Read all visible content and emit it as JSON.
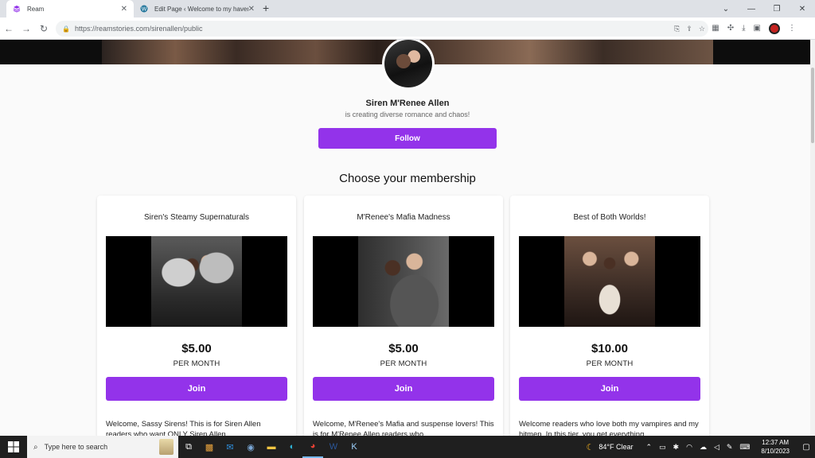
{
  "browser": {
    "tabs": [
      {
        "title": "Ream",
        "active": true
      },
      {
        "title": "Edit Page ‹ Welcome to my haven",
        "active": false
      }
    ],
    "url": "https://reamstories.com/sirenallen/public"
  },
  "creator": {
    "name": "Siren M'Renee Allen",
    "tagline": "is creating diverse romance and chaos!",
    "follow_label": "Follow"
  },
  "membership": {
    "heading": "Choose your membership",
    "tiers": [
      {
        "title": "Siren's Steamy Supernaturals",
        "price": "$5.00",
        "period": "PER MONTH",
        "join_label": "Join",
        "description": "Welcome, Sassy Sirens! This is for Siren Allen readers who want ONLY Siren Allen"
      },
      {
        "title": "M'Renee's Mafia Madness",
        "price": "$5.00",
        "period": "PER MONTH",
        "join_label": "Join",
        "description": "Welcome, M'Renee's Mafia and suspense lovers! This is for M'Renee Allen readers who"
      },
      {
        "title": "Best of Both Worlds!",
        "price": "$10.00",
        "period": "PER MONTH",
        "join_label": "Join",
        "description": "Welcome readers who love both my vampires and my hitmen. In this tier, you get everything"
      }
    ]
  },
  "taskbar": {
    "search_placeholder": "Type here to search",
    "weather": "84°F  Clear",
    "time": "12:37 AM",
    "date": "8/10/2023"
  },
  "colors": {
    "accent": "#9333ea"
  }
}
